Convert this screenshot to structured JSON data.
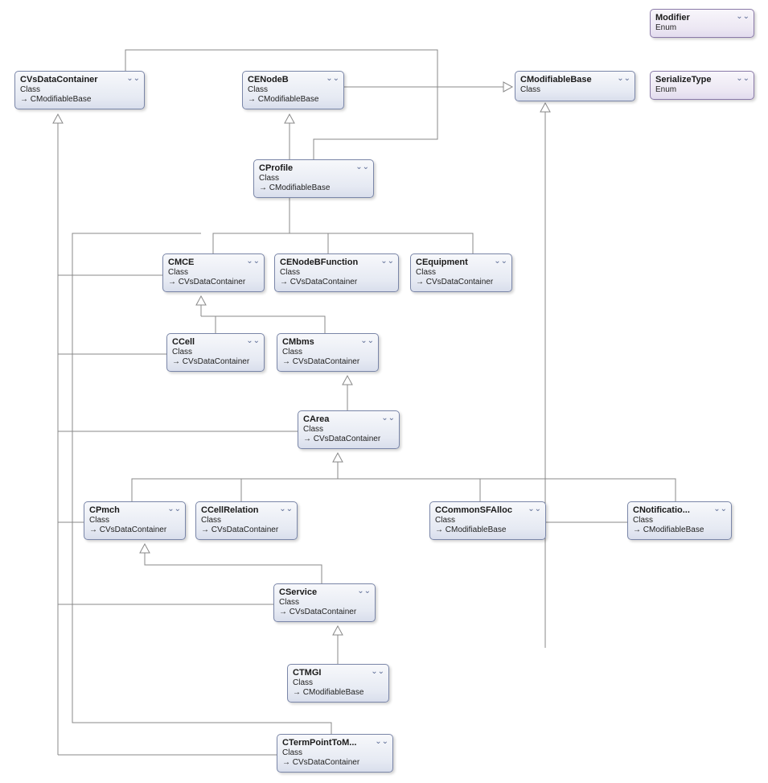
{
  "boxes": {
    "cvsdata": {
      "title": "CVsDataContainer",
      "sub": "Class",
      "inherit": "CModifiableBase"
    },
    "cenodeb": {
      "title": "CENodeB",
      "sub": "Class",
      "inherit": "CModifiableBase"
    },
    "cmodbase": {
      "title": "CModifiableBase",
      "sub": "Class",
      "inherit": ""
    },
    "modifier": {
      "title": "Modifier",
      "sub": "Enum",
      "inherit": ""
    },
    "sertype": {
      "title": "SerializeType",
      "sub": "Enum",
      "inherit": ""
    },
    "cprofile": {
      "title": "CProfile",
      "sub": "Class",
      "inherit": "CModifiableBase"
    },
    "cmce": {
      "title": "CMCE",
      "sub": "Class",
      "inherit": "CVsDataContainer"
    },
    "cenodebfunc": {
      "title": "CENodeBFunction",
      "sub": "Class",
      "inherit": "CVsDataContainer"
    },
    "cequip": {
      "title": "CEquipment",
      "sub": "Class",
      "inherit": "CVsDataContainer"
    },
    "ccell": {
      "title": "CCell",
      "sub": "Class",
      "inherit": "CVsDataContainer"
    },
    "cmbms": {
      "title": "CMbms",
      "sub": "Class",
      "inherit": "CVsDataContainer"
    },
    "carea": {
      "title": "CArea",
      "sub": "Class",
      "inherit": "CVsDataContainer"
    },
    "cpmch": {
      "title": "CPmch",
      "sub": "Class",
      "inherit": "CVsDataContainer"
    },
    "ccellrel": {
      "title": "CCellRelation",
      "sub": "Class",
      "inherit": "CVsDataContainer"
    },
    "ccommonsf": {
      "title": "CCommonSFAlloc",
      "sub": "Class",
      "inherit": "CModifiableBase"
    },
    "cnotif": {
      "title": "CNotificatio...",
      "sub": "Class",
      "inherit": "CModifiableBase"
    },
    "cservice": {
      "title": "CService",
      "sub": "Class",
      "inherit": "CVsDataContainer"
    },
    "ctmgi": {
      "title": "CTMGI",
      "sub": "Class",
      "inherit": "CModifiableBase"
    },
    "cterm": {
      "title": "CTermPointToM...",
      "sub": "Class",
      "inherit": "CVsDataContainer"
    }
  },
  "arrow_prefix": "→ "
}
